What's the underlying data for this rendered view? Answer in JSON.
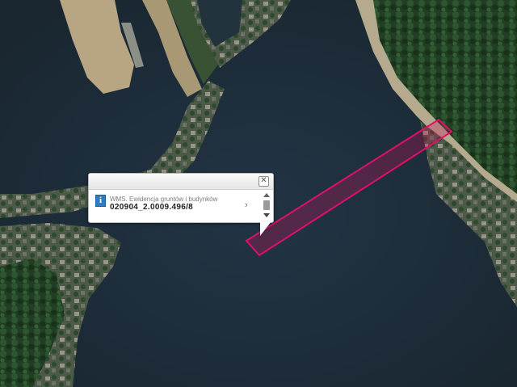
{
  "popup": {
    "layer_name": "WMS. Ewidencja gruntów i budynków",
    "parcel_id": "020904_2.0009.496/8",
    "info_icon": "i",
    "close_icon": "✕",
    "next_icon": "›"
  },
  "colors": {
    "water": "#1f2e3a",
    "parcel_outline": "#e0106a",
    "parcel_fill": "rgba(200,20,90,0.30)",
    "forest": "#1f3d21",
    "sand": "#bfae8e"
  }
}
